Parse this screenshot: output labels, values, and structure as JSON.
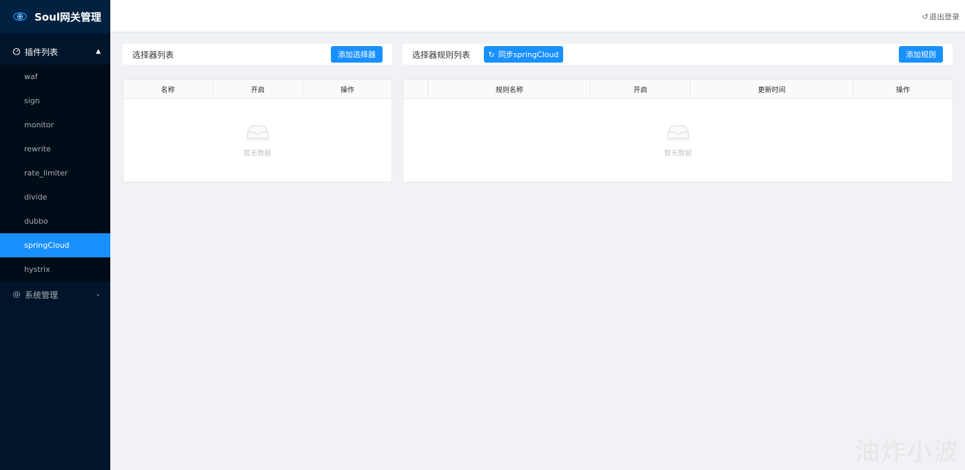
{
  "app": {
    "title": "Soul网关管理",
    "logo_icon": "gateway-logo-icon"
  },
  "sidebar": {
    "plugins_group": {
      "label": "插件列表",
      "icon": "dashboard-icon",
      "expanded": true
    },
    "items": [
      {
        "label": "waf"
      },
      {
        "label": "sign"
      },
      {
        "label": "monitor"
      },
      {
        "label": "rewrite"
      },
      {
        "label": "rate_limiter"
      },
      {
        "label": "divide"
      },
      {
        "label": "dubbo"
      },
      {
        "label": "springCloud",
        "active": true
      },
      {
        "label": "hystrix"
      }
    ],
    "system_group": {
      "label": "系统管理",
      "icon": "setting-icon",
      "expanded": false
    }
  },
  "header": {
    "logout_label": "退出登录",
    "logout_icon": "logout-icon"
  },
  "selector_panel": {
    "title": "选择器列表",
    "add_button": "添加选择器",
    "columns": [
      "名称",
      "开启",
      "操作"
    ],
    "empty_text": "暂无数据"
  },
  "rule_panel": {
    "title": "选择器规则列表",
    "sync_button": "同步springCloud",
    "sync_icon": "sync-icon",
    "add_button": "添加规则",
    "columns": [
      "",
      "规则名称",
      "开启",
      "更新时间",
      "操作"
    ],
    "empty_text": "暂无数据"
  },
  "watermark": "油炸小波",
  "colors": {
    "primary": "#1890ff",
    "sider": "#001529",
    "sider_sub": "#000c17"
  }
}
